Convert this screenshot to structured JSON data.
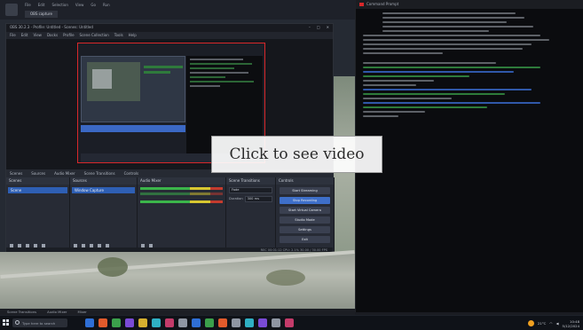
{
  "outer_window": {
    "menu": [
      "File",
      "Edit",
      "Selection",
      "View",
      "Go",
      "Run"
    ],
    "tab_label": "OBS capture"
  },
  "obs": {
    "title": "OBS 30.2.3 - Profile: Untitled - Scenes: Untitled",
    "window_controls": [
      "–",
      "□",
      "✕"
    ],
    "menu": [
      "File",
      "Edit",
      "View",
      "Docks",
      "Profile",
      "Scene Collection",
      "Tools",
      "Help"
    ],
    "dock_tabs": [
      "Scenes",
      "Sources",
      "Audio Mixer",
      "Scene Transitions",
      "Controls"
    ],
    "scenes": {
      "header": "Scenes",
      "selected": "Scene"
    },
    "sources": {
      "header": "Sources",
      "selected": "Window Capture"
    },
    "mixer": {
      "header": "Audio Mixer"
    },
    "transitions": {
      "header": "Scene Transitions",
      "type": "Fade",
      "duration_label": "Duration",
      "duration": "300 ms"
    },
    "controls": {
      "header": "Controls",
      "buttons": [
        "Start Streaming",
        "Stop Recording",
        "Start Virtual Camera",
        "Studio Mode",
        "Settings",
        "Exit"
      ]
    },
    "status": "REC 00:01:12   CPU: 2.1%   30.00 / 30.00 FPS"
  },
  "terminal": {
    "title": "Command Prompt"
  },
  "overlay": {
    "label": "Click to see video"
  },
  "hints": [
    "Scene Transitions",
    "Audio Mixer",
    "Mixer"
  ],
  "taskbar": {
    "search_placeholder": "Type here to search",
    "weather": "21°C",
    "time": "10:48",
    "date": "5/12/2024",
    "colors": {
      "app1": "#2f6fd6",
      "app2": "#e25b2c",
      "app3": "#3ba04b",
      "app4": "#7a4bd6",
      "app5": "#d6b02f",
      "app6": "#2fb0c4",
      "app7": "#c43b6a",
      "app8": "#8f96a3"
    }
  }
}
